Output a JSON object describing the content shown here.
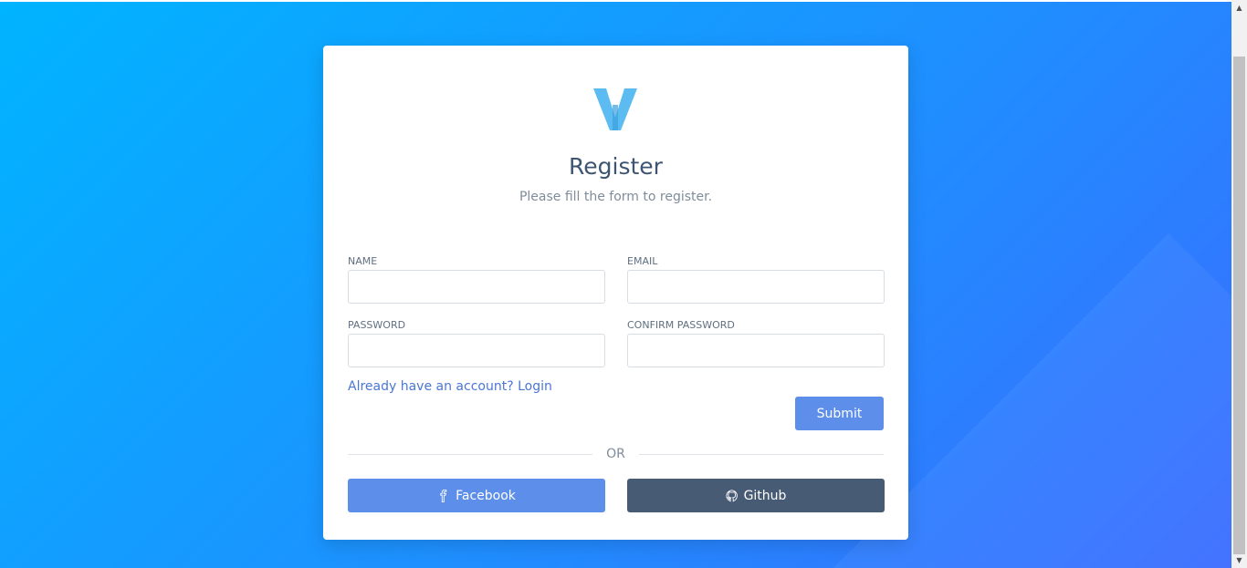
{
  "brand": {
    "logo_letter": "V",
    "accent": "#4db3f0"
  },
  "form": {
    "title": "Register",
    "subtitle": "Please fill the form to register.",
    "fields": {
      "name": {
        "label": "NAME",
        "value": "",
        "placeholder": ""
      },
      "email": {
        "label": "EMAIL",
        "value": "",
        "placeholder": ""
      },
      "password": {
        "label": "PASSWORD",
        "value": "",
        "placeholder": ""
      },
      "confirm_password": {
        "label": "CONFIRM PASSWORD",
        "value": "",
        "placeholder": ""
      }
    },
    "login_link": "Already have an account? Login",
    "submit_label": "Submit",
    "divider_label": "OR",
    "social": {
      "facebook_label": "Facebook",
      "facebook_icon": "facebook-icon",
      "github_label": "Github",
      "github_icon": "github-icon"
    }
  },
  "colors": {
    "primary_button": "#5c8eea",
    "github_button": "#485b75",
    "title": "#3d5473",
    "link": "#4a77d4"
  }
}
